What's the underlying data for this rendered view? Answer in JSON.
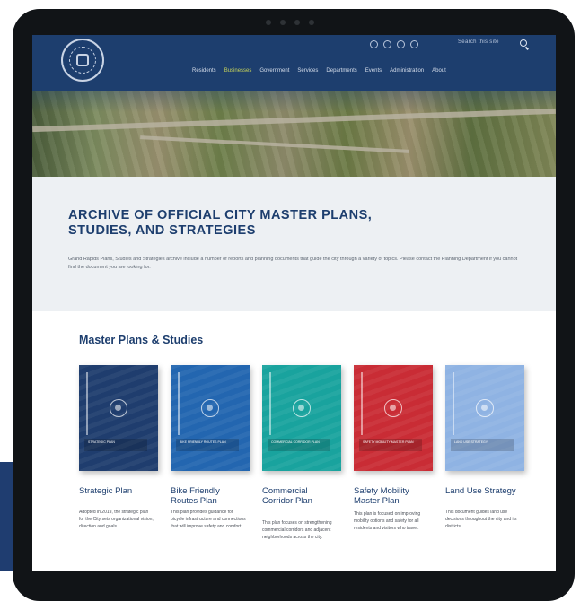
{
  "site": {
    "search_label": "Search this site",
    "nav": [
      "Residents",
      "Businesses",
      "Government",
      "Services",
      "Departments",
      "Events",
      "Administration",
      "About"
    ],
    "active_nav_index": 1
  },
  "page": {
    "title": "ARCHIVE OF OFFICIAL CITY MASTER PLANS, STUDIES, AND STRATEGIES",
    "intro": "Grand Rapids Plans, Studies and Strategies archive include a number of reports and planning documents that guide the city through a variety of topics. Please contact the Planning Department if you cannot find the document you are looking for."
  },
  "section_title": "Master Plans & Studies",
  "cards": [
    {
      "title": "Strategic Plan",
      "cover_text": "STRATEGIC PLAN",
      "cover_color": "#1f3d6e",
      "desc": "Adopted in 2019, the strategic plan for the City sets organizational vision, direction and goals."
    },
    {
      "title": "Bike Friendly Routes Plan",
      "cover_text": "BIKE FRIENDLY ROUTES PLAN",
      "cover_color": "#2366b0",
      "desc": "This plan provides guidance for bicycle infrastructure and connections that will improve safety and comfort."
    },
    {
      "title": "Commercial Corridor Plan",
      "cover_text": "COMMERCIAL CORRIDOR PLAN",
      "cover_color": "#19a39e",
      "desc": "This plan focuses on strengthening commercial corridors and adjacent neighborhoods across the city."
    },
    {
      "title": "Safety Mobility Master Plan",
      "cover_text": "SAFETY MOBILITY MASTER PLAN",
      "cover_color": "#c92c35",
      "desc": "This plan is focused on improving mobility options and safety for all residents and visitors who travel."
    },
    {
      "title": "Land Use Strategy",
      "cover_text": "LAND USE STRATEGY",
      "cover_color": "#8fb3e3",
      "desc": "This document guides land use decisions throughout the city and its districts."
    }
  ]
}
